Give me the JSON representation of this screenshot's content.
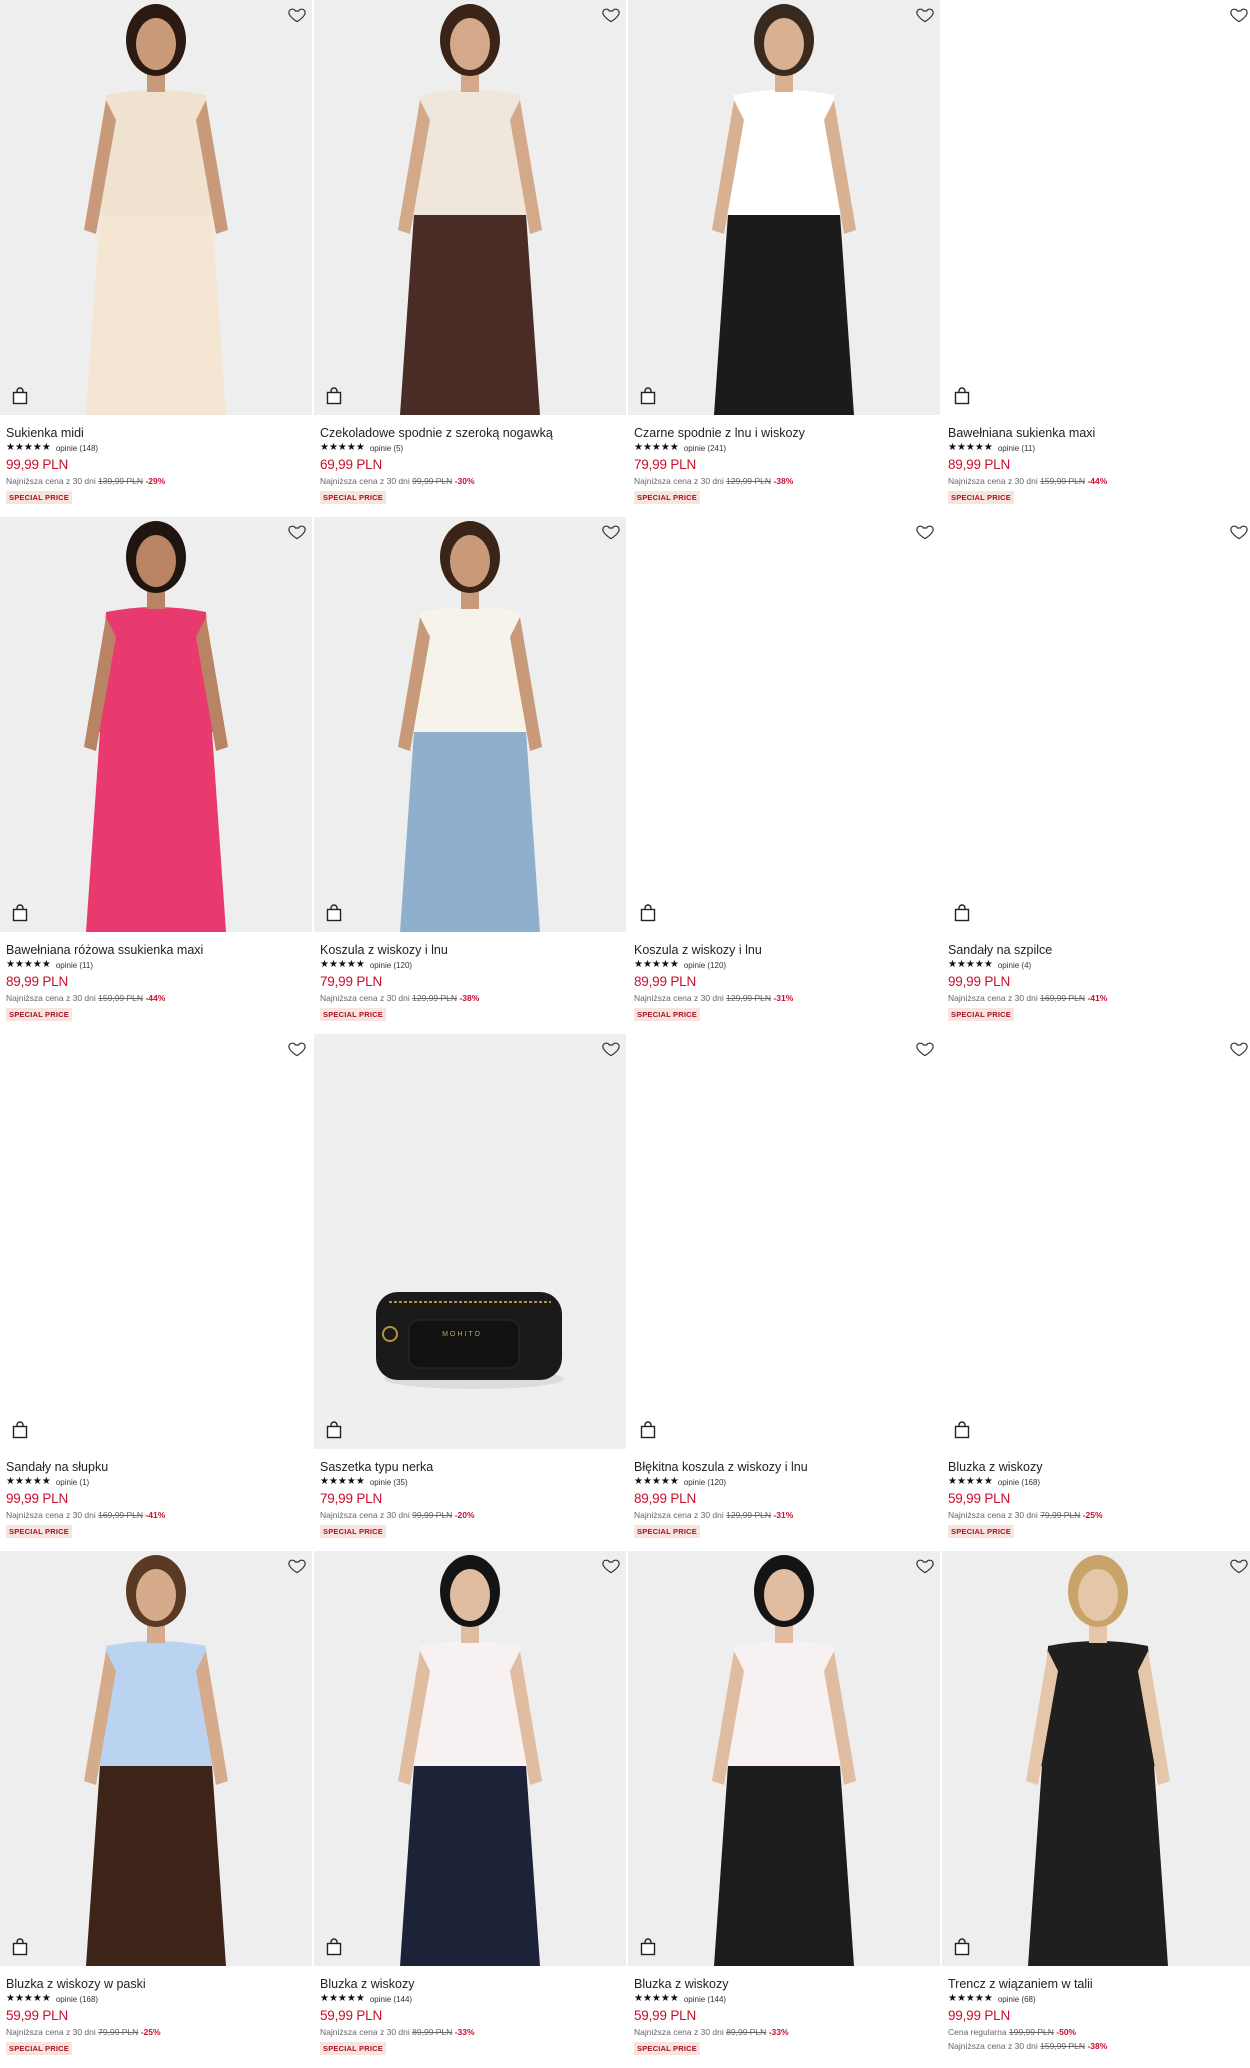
{
  "colors": {
    "price": "#c8102e",
    "badge_bg": "#f7e4dc",
    "badge_text": "#a8122a",
    "image_bg": "#f1f1f1"
  },
  "products": [
    {
      "name": "Sukienka midi",
      "stars": "★★★★★",
      "reviews": "opinie (148)",
      "price": "99,99 PLN",
      "lowest_label": "Najniższa cena z 30 dni",
      "old_price": "139,99 PLN",
      "discount": "-29%",
      "badge": "SPECIAL PRICE",
      "image": "photo",
      "top": "#efe3cf",
      "bottom": "#f4e6d3",
      "skin": "#c99a7a",
      "hair": "#2a1a12"
    },
    {
      "name": "Czekoladowe spodnie z szeroką nogawką",
      "stars": "★★★★★",
      "reviews": "opinie (5)",
      "price": "69,99 PLN",
      "lowest_label": "Najniższa cena z 30 dni",
      "old_price": "99,99 PLN",
      "discount": "-30%",
      "badge": "SPECIAL PRICE",
      "image": "photo",
      "top": "#efe6dc",
      "bottom": "#4a2c26",
      "skin": "#d3a98a",
      "hair": "#3a2418"
    },
    {
      "name": "Czarne spodnie z lnu i wiskozy",
      "stars": "★★★★★",
      "reviews": "opinie (241)",
      "price": "79,99 PLN",
      "lowest_label": "Najniższa cena z 30 dni",
      "old_price": "129,99 PLN",
      "discount": "-38%",
      "badge": "SPECIAL PRICE",
      "image": "photo",
      "top": "#ffffff",
      "bottom": "#1b1b1b",
      "skin": "#d8b092",
      "hair": "#3a2a1e"
    },
    {
      "name": "Bawełniana sukienka maxi",
      "stars": "★★★★★",
      "reviews": "opinie (11)",
      "price": "89,99 PLN",
      "lowest_label": "Najniższa cena z 30 dni",
      "old_price": "159,99 PLN",
      "discount": "-44%",
      "badge": "SPECIAL PRICE",
      "image": "blank"
    },
    {
      "name": "Bawełniana różowa ssukienka maxi",
      "stars": "★★★★★",
      "reviews": "opinie (11)",
      "price": "89,99 PLN",
      "lowest_label": "Najniższa cena z 30 dni",
      "old_price": "159,99 PLN",
      "discount": "-44%",
      "badge": "SPECIAL PRICE",
      "image": "photo",
      "top": "#e83a6e",
      "bottom": "#e83a6e",
      "skin": "#b98463",
      "hair": "#1e1410"
    },
    {
      "name": "Koszula z wiskozy i lnu",
      "stars": "★★★★★",
      "reviews": "opinie (120)",
      "price": "79,99 PLN",
      "lowest_label": "Najniższa cena z 30 dni",
      "old_price": "129,99 PLN",
      "discount": "-38%",
      "badge": "SPECIAL PRICE",
      "image": "photo",
      "top": "#f6f3ea",
      "bottom": "#8fb0cc",
      "skin": "#c99a7a",
      "hair": "#3a2418"
    },
    {
      "name": "Koszula z wiskozy i lnu",
      "stars": "★★★★★",
      "reviews": "opinie (120)",
      "price": "89,99 PLN",
      "lowest_label": "Najniższa cena z 30 dni",
      "old_price": "129,99 PLN",
      "discount": "-31%",
      "badge": "SPECIAL PRICE",
      "image": "blank"
    },
    {
      "name": "Sandały na szpilce",
      "stars": "★★★★★",
      "reviews": "opinie (4)",
      "price": "99,99 PLN",
      "lowest_label": "Najniższa cena z 30 dni",
      "old_price": "169,99 PLN",
      "discount": "-41%",
      "badge": "SPECIAL PRICE",
      "image": "blank"
    },
    {
      "name": "Sandały na słupku",
      "stars": "★★★★★",
      "reviews": "opinie (1)",
      "price": "99,99 PLN",
      "lowest_label": "Najniższa cena z 30 dni",
      "old_price": "169,99 PLN",
      "discount": "-41%",
      "badge": "SPECIAL PRICE",
      "image": "blank"
    },
    {
      "name": "Saszetka typu nerka",
      "stars": "★★★★★",
      "reviews": "opinie (35)",
      "price": "79,99 PLN",
      "lowest_label": "Najniższa cena z 30 dni",
      "old_price": "99,99 PLN",
      "discount": "-20%",
      "badge": "SPECIAL PRICE",
      "image": "bag",
      "bag_brand": "MOHITO"
    },
    {
      "name": "Błękitna koszula z wiskozy i lnu",
      "stars": "★★★★★",
      "reviews": "opinie (120)",
      "price": "89,99 PLN",
      "lowest_label": "Najniższa cena z 30 dni",
      "old_price": "129,99 PLN",
      "discount": "-31%",
      "badge": "SPECIAL PRICE",
      "image": "blank"
    },
    {
      "name": "Bluzka z wiskozy",
      "stars": "★★★★★",
      "reviews": "opinie (168)",
      "price": "59,99 PLN",
      "lowest_label": "Najniższa cena z 30 dni",
      "old_price": "79,99 PLN",
      "discount": "-25%",
      "badge": "SPECIAL PRICE",
      "image": "blank"
    },
    {
      "name": "Bluzka z wiskozy w paski",
      "stars": "★★★★★",
      "reviews": "opinie (168)",
      "price": "59,99 PLN",
      "lowest_label": "Najniższa cena z 30 dni",
      "old_price": "79,99 PLN",
      "discount": "-25%",
      "badge": "SPECIAL PRICE",
      "image": "photo",
      "top": "#b9d3f0",
      "bottom": "#3e2418",
      "skin": "#d6ab8c",
      "hair": "#5a3a24"
    },
    {
      "name": "Bluzka z wiskozy",
      "stars": "★★★★★",
      "reviews": "opinie (144)",
      "price": "59,99 PLN",
      "lowest_label": "Najniższa cena z 30 dni",
      "old_price": "89,99 PLN",
      "discount": "-33%",
      "badge": "SPECIAL PRICE",
      "image": "photo",
      "top": "#f7f1f2",
      "bottom": "#1c2238",
      "skin": "#e0bca0",
      "hair": "#141414"
    },
    {
      "name": "Bluzka z wiskozy",
      "stars": "★★★★★",
      "reviews": "opinie (144)",
      "price": "59,99 PLN",
      "lowest_label": "Najniższa cena z 30 dni",
      "old_price": "89,99 PLN",
      "discount": "-33%",
      "badge": "SPECIAL PRICE",
      "image": "photo",
      "top": "#f7f1f2",
      "bottom": "#1c1c1c",
      "skin": "#e0bca0",
      "hair": "#141414"
    },
    {
      "name": "Trencz z wiązaniem w talii",
      "stars": "★★★★★",
      "reviews": "opinie (68)",
      "price": "99,99 PLN",
      "regular_label": "Cena regularna",
      "regular_price": "199,99 PLN",
      "regular_discount": "-50%",
      "lowest_label": "Najniższa cena z 30 dni",
      "old_price": "159,99 PLN",
      "discount": "-38%",
      "badge": "",
      "image": "photo",
      "top": "#1f1f1f",
      "bottom": "#1f1f1f",
      "skin": "#e6c6a8",
      "hair": "#c9a46a"
    }
  ]
}
